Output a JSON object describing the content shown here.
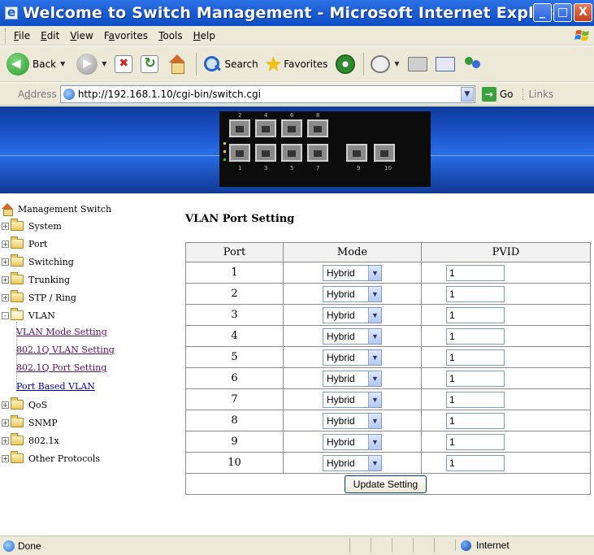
{
  "window": {
    "title": "Welcome to Switch Management - Microsoft Internet Explorer",
    "controls": {
      "minimize": "_",
      "maximize": "□",
      "close": "X"
    }
  },
  "menubar": {
    "items": [
      {
        "label": "File",
        "hotkey_letter": "F",
        "rest": "ile"
      },
      {
        "label": "Edit",
        "hotkey_letter": "E",
        "rest": "dit"
      },
      {
        "label": "View",
        "hotkey_letter": "V",
        "rest": "iew"
      },
      {
        "label": "Favorites",
        "pre": "F",
        "hotkey_letter": "a",
        "rest": "vorites"
      },
      {
        "label": "Tools",
        "hotkey_letter": "T",
        "rest": "ools"
      },
      {
        "label": "Help",
        "hotkey_letter": "H",
        "rest": "elp"
      }
    ]
  },
  "toolbar": {
    "back_label": "Back",
    "search_label": "Search",
    "favorites_label": "Favorites"
  },
  "addressbar": {
    "label_pre": "A",
    "label_hot": "d",
    "label_rest": "dress",
    "url": "http://192.168.1.10/cgi-bin/switch.cgi",
    "go_label": "Go",
    "links_label": "Links"
  },
  "banner": {
    "port_labels_top": [
      "2",
      "4",
      "6",
      "8"
    ],
    "port_labels_bottom": [
      "1",
      "3",
      "5",
      "7"
    ],
    "uplink_labels": [
      "9",
      "10"
    ]
  },
  "sidebar": {
    "root_label": "Management Switch",
    "items": [
      {
        "label": "System",
        "expander": "+"
      },
      {
        "label": "Port",
        "expander": "+"
      },
      {
        "label": "Switching",
        "expander": "+"
      },
      {
        "label": "Trunking",
        "expander": "+"
      },
      {
        "label": "STP / Ring",
        "expander": "+"
      },
      {
        "label": "VLAN",
        "expander": "-"
      },
      {
        "label": "QoS",
        "expander": "+"
      },
      {
        "label": "SNMP",
        "expander": "+"
      },
      {
        "label": "802.1x",
        "expander": "+"
      },
      {
        "label": "Other Protocols",
        "expander": "+"
      }
    ],
    "vlan_links": [
      "VLAN Mode Setting",
      "802.1Q VLAN Setting",
      "802.1Q Port Setting",
      "Port Based VLAN"
    ]
  },
  "main": {
    "title": "VLAN Port Setting",
    "headers": {
      "port": "Port",
      "mode": "Mode",
      "pvid": "PVID"
    },
    "rows": [
      {
        "port": "1",
        "mode": "Hybrid",
        "pvid": "1"
      },
      {
        "port": "2",
        "mode": "Hybrid",
        "pvid": "1"
      },
      {
        "port": "3",
        "mode": "Hybrid",
        "pvid": "1"
      },
      {
        "port": "4",
        "mode": "Hybrid",
        "pvid": "1"
      },
      {
        "port": "5",
        "mode": "Hybrid",
        "pvid": "1"
      },
      {
        "port": "6",
        "mode": "Hybrid",
        "pvid": "1"
      },
      {
        "port": "7",
        "mode": "Hybrid",
        "pvid": "1"
      },
      {
        "port": "8",
        "mode": "Hybrid",
        "pvid": "1"
      },
      {
        "port": "9",
        "mode": "Hybrid",
        "pvid": "1"
      },
      {
        "port": "10",
        "mode": "Hybrid",
        "pvid": "1"
      }
    ],
    "update_button": "Update Setting"
  },
  "statusbar": {
    "status": "Done",
    "zone": "Internet"
  },
  "colors": {
    "titlebar": "#1f5fd6",
    "chrome": "#ece9d8",
    "banner": "#1a52c8",
    "visited_link": "#5a0f66",
    "link": "#0000b0"
  }
}
